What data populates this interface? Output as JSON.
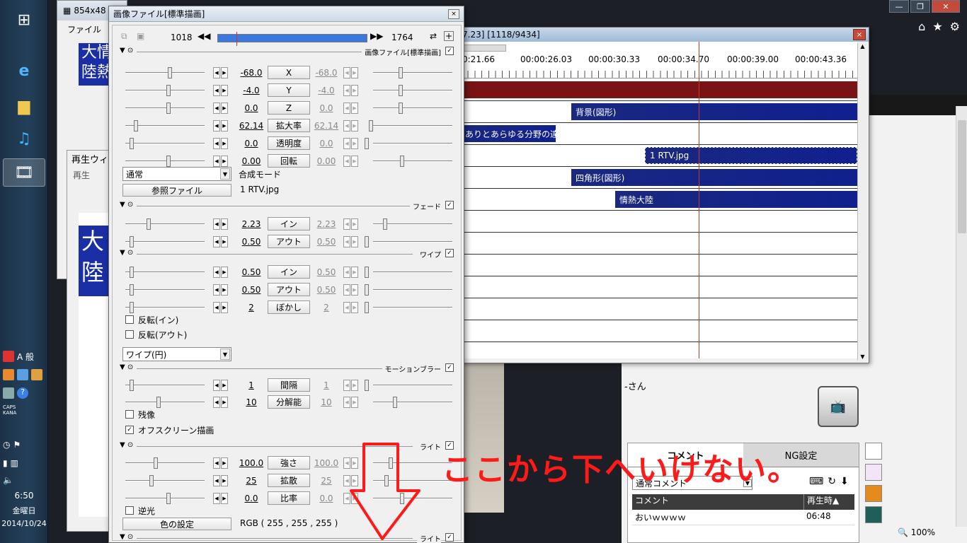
{
  "taskbar": {
    "clock_time": "6:50",
    "clock_day": "金曜日",
    "clock_date": "2014/10/24",
    "ime_label": "A 般",
    "caps": "CAPS",
    "kana": "KANA"
  },
  "video_window": {
    "title": "854x48",
    "menu_file": "ファイル",
    "preview_text": "大情\n陸熱"
  },
  "play_window": {
    "title": "再生ウィ",
    "menu_play": "再生",
    "preview_text": "大\n陸"
  },
  "timeline": {
    "title": "7.23] [1118/9434]",
    "close": "×",
    "times": [
      "0:21.66",
      "00:00:26.03",
      "00:00:30.33",
      "00:00:34.70",
      "00:00:39.00",
      "00:00:43.36"
    ],
    "clips": [
      {
        "label": "背景(図形)"
      },
      {
        "label": "ありとあらゆる分野の達"
      },
      {
        "label": "1 RTV.jpg"
      },
      {
        "label": "四角形(図形)"
      },
      {
        "label": "情熱大陸"
      }
    ]
  },
  "dialog": {
    "title": "画像ファイル[標準描画]",
    "close": "×",
    "frame_start": "1018",
    "frame_end": "1764",
    "sections": {
      "image": "画像ファイル[標準描画]",
      "fade": "フェード",
      "wipe": "ワイプ",
      "motionblur": "モーションブラー",
      "light1": "ライト",
      "light2": "ライト"
    },
    "params": {
      "x": {
        "left": "-68.0",
        "label": "X",
        "right": "-68.0"
      },
      "y": {
        "left": "-4.0",
        "label": "Y",
        "right": "-4.0"
      },
      "z": {
        "left": "0.0",
        "label": "Z",
        "right": "0.0"
      },
      "scale": {
        "left": "62.14",
        "label": "拡大率",
        "right": "62.14"
      },
      "alpha": {
        "left": "0.0",
        "label": "透明度",
        "right": "0.0"
      },
      "rotate": {
        "left": "0.00",
        "label": "回転",
        "right": "0.00"
      },
      "fade_in": {
        "left": "2.23",
        "label": "イン",
        "right": "2.23"
      },
      "fade_out": {
        "left": "0.50",
        "label": "アウト",
        "right": "0.50"
      },
      "wipe_in": {
        "left": "0.50",
        "label": "イン",
        "right": "0.50"
      },
      "wipe_out": {
        "left": "0.50",
        "label": "アウト",
        "right": "0.50"
      },
      "wipe_blur": {
        "left": "2",
        "label": "ぼかし",
        "right": "2"
      },
      "mb_interval": {
        "left": "1",
        "label": "間隔",
        "right": "1"
      },
      "mb_res": {
        "left": "10",
        "label": "分解能",
        "right": "10"
      },
      "light_strength": {
        "left": "100.0",
        "label": "強さ",
        "right": "100.0"
      },
      "light_diffuse": {
        "left": "25",
        "label": "拡散",
        "right": "25"
      },
      "light_ratio": {
        "left": "0.0",
        "label": "比率",
        "right": "0.0"
      }
    },
    "blend_mode_value": "通常",
    "blend_mode_label": "合成モード",
    "ref_file_button": "参照ファイル",
    "ref_file_name": "1 RTV.jpg",
    "invert_in": "反転(イン)",
    "invert_out": "反転(アウト)",
    "wipe_type": "ワイプ(円)",
    "afterimage": "残像",
    "offscreen": "オフスクリーン描画",
    "backlight": "逆光",
    "color_button": "色の設定",
    "rgb": "RGB ( 255 , 255 , 255 )"
  },
  "comments": {
    "user_suffix": "-さん",
    "tab_comment": "コメント",
    "tab_ng": "NG設定",
    "mode": "通常コメント",
    "col_comment": "コメント",
    "col_time": "再生時▲",
    "row_text": "おいｗｗｗｗ",
    "row_time": "06:48",
    "zoom": "100%"
  },
  "annotation": "ここから下へいけない。",
  "colors": {
    "annotation": "#ff1a1a",
    "clip_navy": "#10208e",
    "clip_red": "#7a1414",
    "frame_bar": "#3a78e0"
  }
}
